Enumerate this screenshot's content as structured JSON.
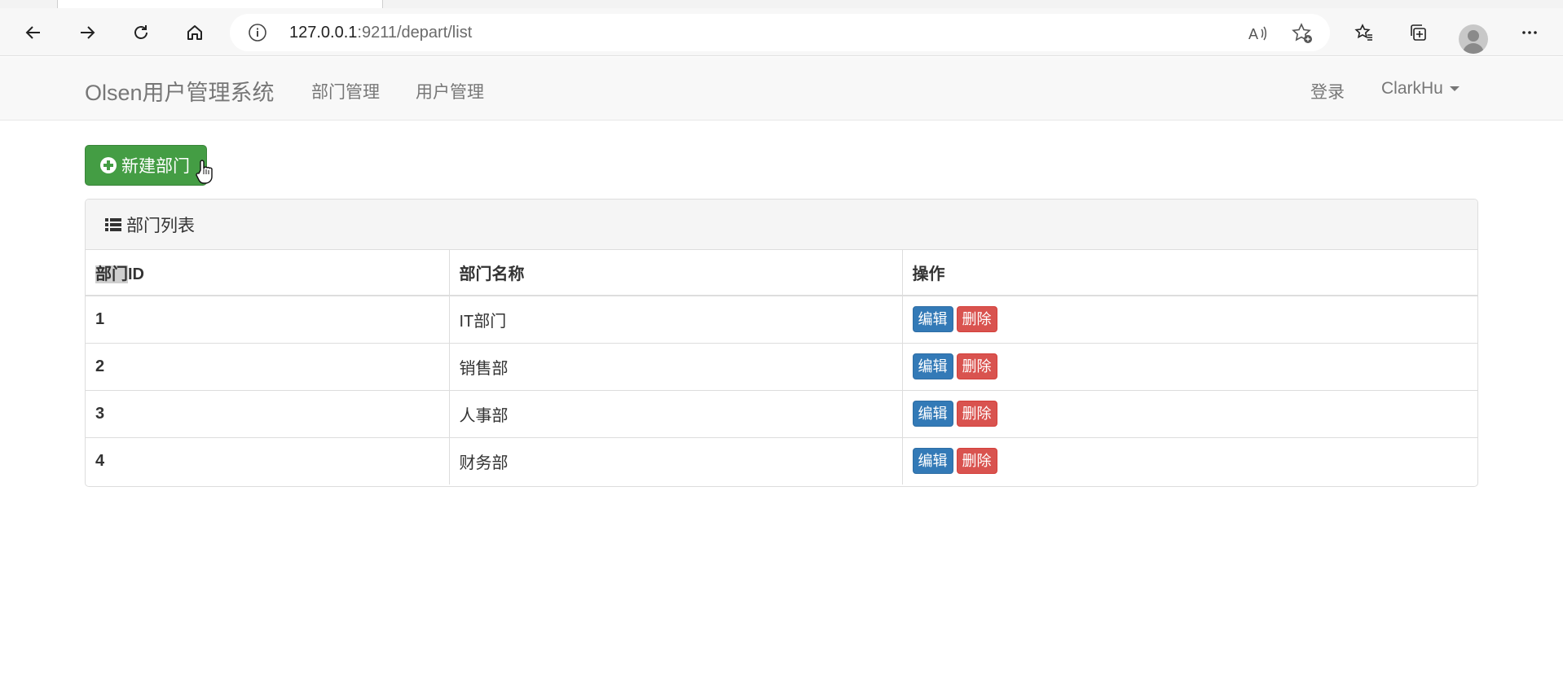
{
  "browser": {
    "url_host": "127.0.0.1",
    "url_path": ":9211/depart/list"
  },
  "navbar": {
    "brand": "Olsen用户管理系统",
    "links": [
      "部门管理",
      "用户管理"
    ],
    "login": "登录",
    "user": "ClarkHu"
  },
  "actions": {
    "new_button": "新建部门"
  },
  "panel": {
    "title": "部门列表",
    "columns": [
      "部门ID",
      "部门名称",
      "操作"
    ],
    "header_id_highlight": "部门",
    "header_id_rest": "ID",
    "rows": [
      {
        "id": "1",
        "name": "IT部门"
      },
      {
        "id": "2",
        "name": "销售部"
      },
      {
        "id": "3",
        "name": "人事部"
      },
      {
        "id": "4",
        "name": "财务部"
      }
    ],
    "edit_label": "编辑",
    "delete_label": "删除"
  },
  "colors": {
    "success": "#449d44",
    "primary": "#337ab7",
    "danger": "#d9534f"
  }
}
